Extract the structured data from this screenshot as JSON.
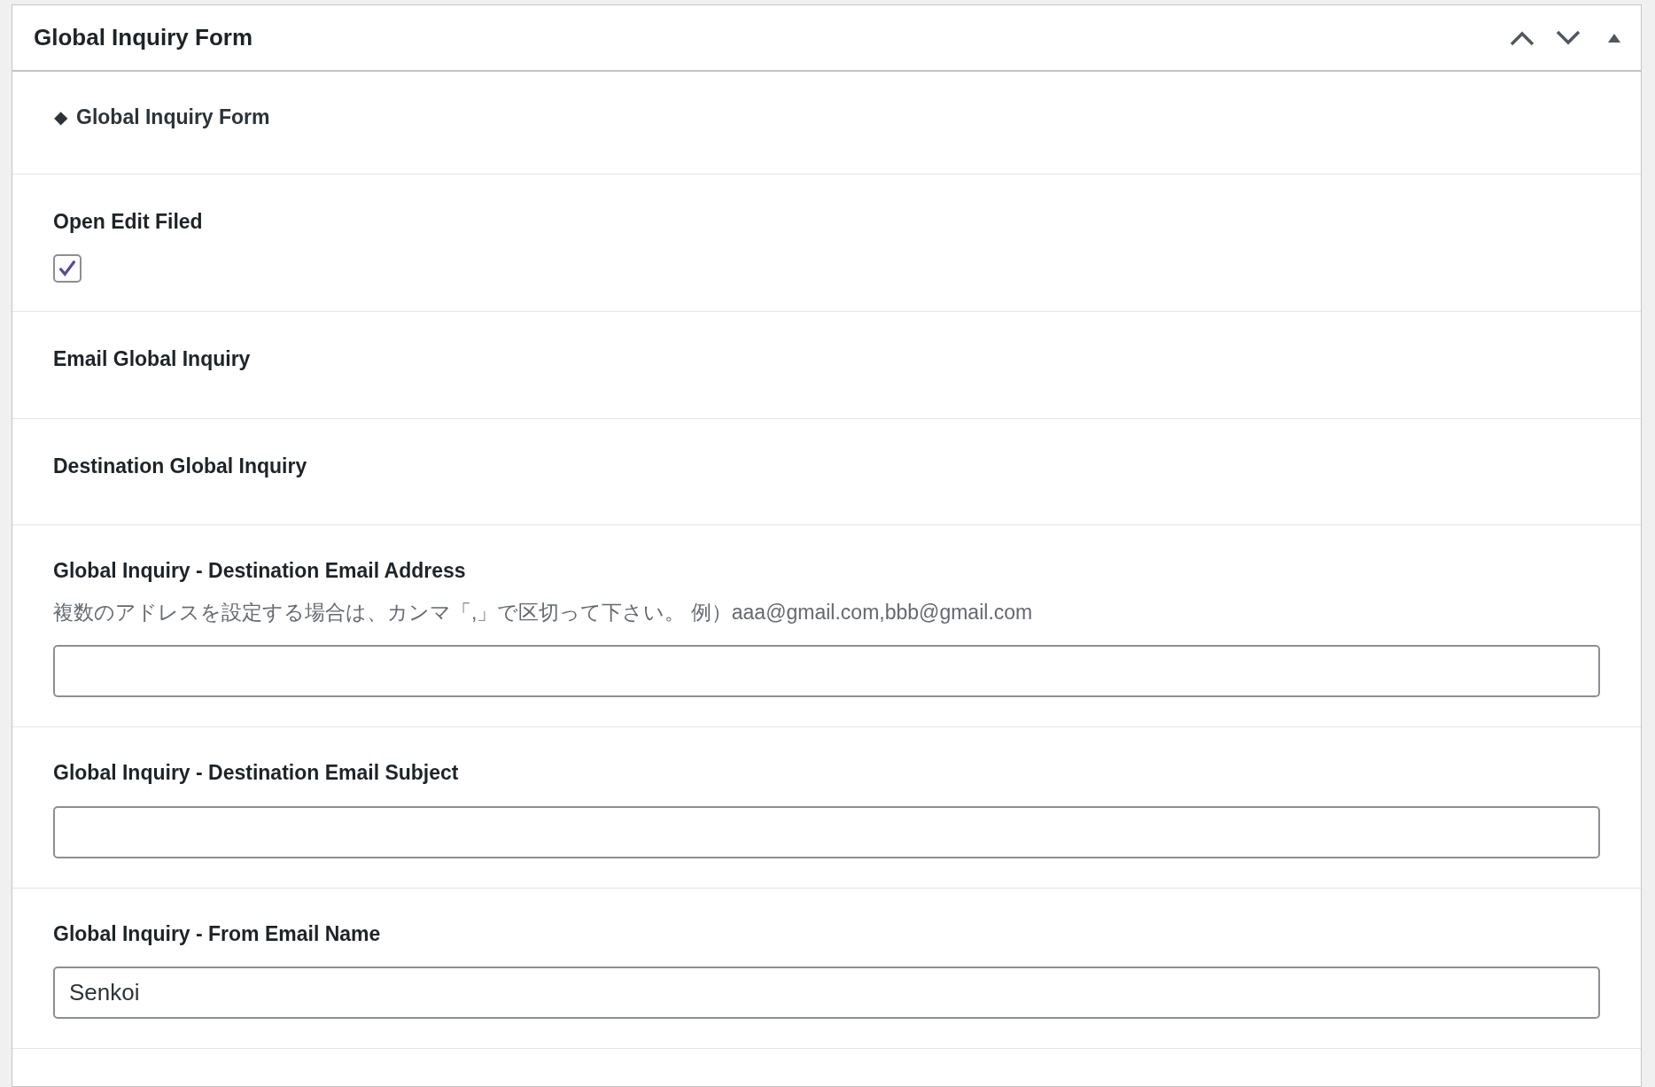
{
  "panel": {
    "title": "Global Inquiry Form"
  },
  "sections": [
    {
      "kind": "heading",
      "marker": "◆",
      "label": "Global Inquiry Form"
    },
    {
      "kind": "checkbox",
      "label": "Open Edit Filed",
      "checked": true
    },
    {
      "kind": "label",
      "label": "Email Global Inquiry"
    },
    {
      "kind": "label",
      "label": "Destination Global Inquiry"
    },
    {
      "kind": "field",
      "label": "Global Inquiry - Destination Email Address",
      "description": "複数のアドレスを設定する場合は、カンマ「,」で区切って下さい。 例）aaa@gmail.com,bbb@gmail.com"
    },
    {
      "kind": "field",
      "label": "Global Inquiry - Destination Email Subject"
    },
    {
      "kind": "field",
      "label": "Global Inquiry - From Email Name",
      "value": "Senkoi"
    }
  ]
}
